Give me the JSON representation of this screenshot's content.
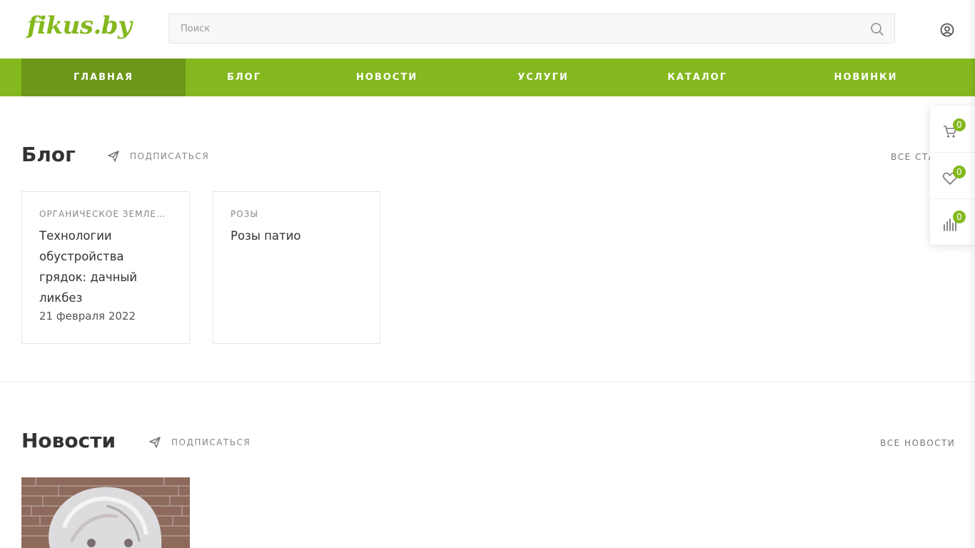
{
  "header": {
    "logo_text": "fikus.by",
    "search_placeholder": "Поиск"
  },
  "nav": {
    "items": [
      {
        "label": "ГЛАВНАЯ",
        "active": true
      },
      {
        "label": "БЛОГ",
        "active": false
      },
      {
        "label": "НОВОСТИ",
        "active": false
      },
      {
        "label": "УСЛУГИ",
        "active": false
      },
      {
        "label": "КАТАЛОГ",
        "active": false
      },
      {
        "label": "НОВИНКИ",
        "active": false
      }
    ]
  },
  "blog": {
    "title": "Блог",
    "subscribe_label": "ПОДПИСАТЬСЯ",
    "all_link": "ВСЕ СТА",
    "cards": [
      {
        "category": "ОРГАНИЧЕСКОЕ ЗЕМЛЕ…",
        "title": "Технологии обустройства грядок: дачный ликбез",
        "date": "21 февраля 2022"
      },
      {
        "category": "РОЗЫ",
        "title": "Розы патио",
        "date": ""
      }
    ]
  },
  "news": {
    "title": "Новости",
    "subscribe_label": "ПОДПИСАТЬСЯ",
    "all_link": "ВСЕ НОВОСТИ"
  },
  "side_panel": {
    "cart_count": "0",
    "favorites_count": "0",
    "compare_count": "0"
  },
  "colors": {
    "brand_green": "#84b81f",
    "active_nav": "#6d9718"
  },
  "icons": [
    "search-icon",
    "user-icon",
    "send-icon",
    "cart-icon",
    "heart-icon",
    "compare-icon"
  ]
}
